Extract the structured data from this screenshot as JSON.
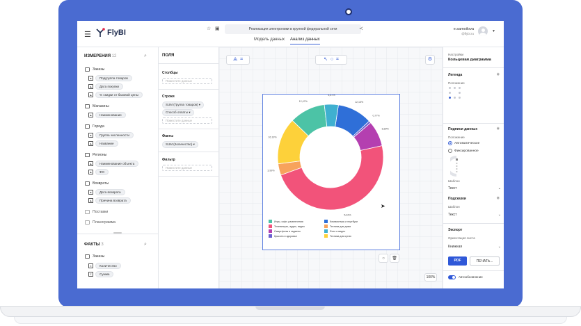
{
  "app": {
    "logo": "FlyBI",
    "doc_title": "Реализация электроники в крупной федеральной сети",
    "tabs": [
      "Модель данных",
      "Анализ данных"
    ],
    "active_tab": 1,
    "user": {
      "name": "e.samoilova",
      "email": "@flybi.ru"
    }
  },
  "dimensions": {
    "title": "ИЗМЕРЕНИЯ",
    "count": "12",
    "groups": [
      {
        "label": "Заказы",
        "fields": [
          "Подгруппа товаров",
          "Дата покупки",
          "% скидки от базовой цены"
        ]
      },
      {
        "label": "Магазины",
        "fields": [
          "Наименование"
        ]
      },
      {
        "label": "Города",
        "fields": [
          "Группа численности",
          "Название"
        ]
      },
      {
        "label": "Регионы",
        "fields": [
          "Наименование объекта",
          "ФО"
        ]
      },
      {
        "label": "Возвраты",
        "fields": [
          "Дата возврата",
          "Причина возврата"
        ]
      },
      {
        "label": "Поставки",
        "fields": []
      },
      {
        "label": "Планограмма",
        "fields": []
      }
    ]
  },
  "facts": {
    "title": "ФАКТЫ",
    "count": "3",
    "group": "Заказы",
    "fields": [
      "Количество",
      "Сумма"
    ]
  },
  "fields_panel": {
    "title": "ПОЛЯ",
    "columns_label": "Столбцы",
    "rows_label": "Строки",
    "facts_label": "Факты",
    "filter_label": "Фильтр",
    "placeholder": "Поместите данные",
    "row_fields": [
      "SUM (Группа товаров)",
      "Способ оплаты"
    ],
    "fact_fields": [
      "SUM (Количество)"
    ]
  },
  "chart_data": {
    "type": "pie",
    "donut": true,
    "slices": [
      {
        "label": "Компьютеры и ноутбуки",
        "value": 12.15,
        "display": "12,15%",
        "color": "#2f6fd8"
      },
      {
        "label": "Фото и видео",
        "value": 0.77,
        "display": "0,77%",
        "color": "#6a5fcf"
      },
      {
        "label": "Смартфоны и гаджеты",
        "value": 8.89,
        "display": "8,89%",
        "color": "#b43fb0"
      },
      {
        "label": "Телевизоры, аудио, видео",
        "value": 54.6,
        "display": "54,6%",
        "color": "#f2537a"
      },
      {
        "label": "Техника для дома",
        "value": 3.99,
        "display": "3,99%",
        "color": "#f7a35c"
      },
      {
        "label": "Техника для кухни",
        "value": 16.19,
        "display": "16,19%",
        "color": "#fdd13a"
      },
      {
        "label": "Игры, софт, развлечения",
        "value": 12.47,
        "display": "12,47%",
        "color": "#4cc3a6"
      },
      {
        "label": "Красота и здоровье",
        "value": 4.87,
        "display": "4,87%",
        "color": "#3fb0d0"
      }
    ],
    "legend": [
      {
        "label": "Игры, софт, развлечения",
        "color": "#4cc3a6"
      },
      {
        "label": "Компьютеры и ноутбуки",
        "color": "#2f6fd8"
      },
      {
        "label": "Телевизоры, аудио, видео",
        "color": "#f2537a"
      },
      {
        "label": "Техника для дома",
        "color": "#f7a35c"
      },
      {
        "label": "Смартфоны и гаджеты",
        "color": "#b43fb0"
      },
      {
        "label": "Фото и видео",
        "color": "#3fb0d0"
      },
      {
        "label": "Красота и здоровье",
        "color": "#6a5fcf"
      },
      {
        "label": "Техника для кухни",
        "color": "#fdd13a"
      }
    ]
  },
  "canvas": {
    "zoom": "100%"
  },
  "settings": {
    "small_title": "Настройки",
    "title": "Кольцевая диаграмма",
    "legend_label": "Легенда",
    "position_label": "Положение",
    "data_labels_label": "Подписи данных",
    "position_label2": "Положение",
    "radio_auto": "Автоматическое",
    "radio_fixed": "Фиксированное",
    "template_label": "Шаблон",
    "template_value": "Текст",
    "tooltips_label": "Подсказки",
    "template_label2": "Шаблон",
    "template_value2": "Текст",
    "export_label": "Экспорт",
    "orientation_label": "Ориентация листа",
    "orientation_value": "Книжная",
    "pdf_button": "PDF",
    "print_button": "ПЕЧАТЬ...",
    "auto_update": "Автообновление"
  }
}
